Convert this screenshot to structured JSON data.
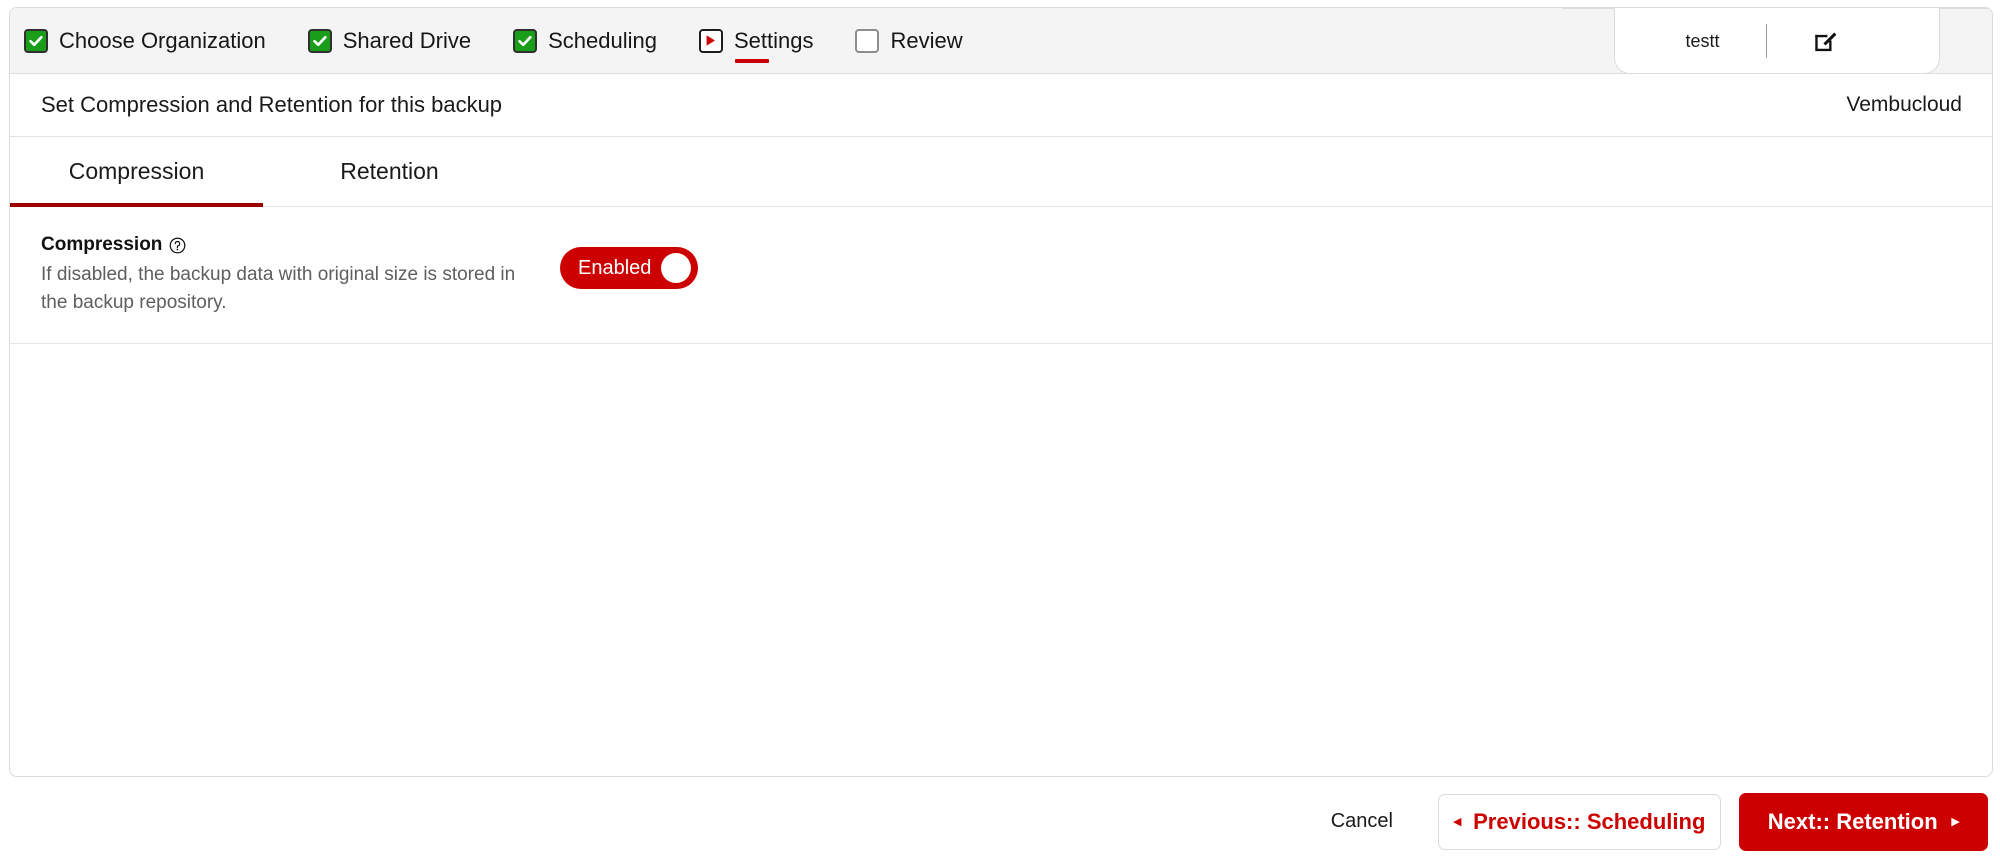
{
  "wizard": {
    "steps": [
      {
        "label": "Choose Organization",
        "state": "done",
        "icon": "checkbox-checked-icon"
      },
      {
        "label": "Shared Drive",
        "state": "done",
        "icon": "checkbox-checked-icon"
      },
      {
        "label": "Scheduling",
        "state": "done",
        "icon": "checkbox-checked-icon"
      },
      {
        "label": "Settings",
        "state": "current",
        "icon": "play-triangle-icon"
      },
      {
        "label": "Review",
        "state": "todo",
        "icon": "checkbox-empty-icon"
      }
    ]
  },
  "profile": {
    "name": "testt",
    "edit_icon": "edit-pencil-square-icon"
  },
  "page": {
    "title": "Set Compression and Retention for this backup",
    "account": "Vembucloud"
  },
  "tabs": [
    {
      "label": "Compression",
      "active": true
    },
    {
      "label": "Retention",
      "active": false
    }
  ],
  "compression": {
    "title": "Compression",
    "help_icon": "help-question-circle-icon",
    "description": "If disabled, the backup data with original size is stored in the backup repository.",
    "toggle_label": "Enabled",
    "toggle_state": "on"
  },
  "footer": {
    "cancel_label": "Cancel",
    "previous_label": "Previous:: Scheduling",
    "previous_arrow": "◂",
    "next_label": "Next:: Retention",
    "next_arrow": "▸"
  },
  "colors": {
    "accent_red": "#cc0000",
    "tab_underline_red": "#9c0000",
    "step_done_green": "#1a9e1a",
    "header_bg": "#f4f4f4"
  }
}
